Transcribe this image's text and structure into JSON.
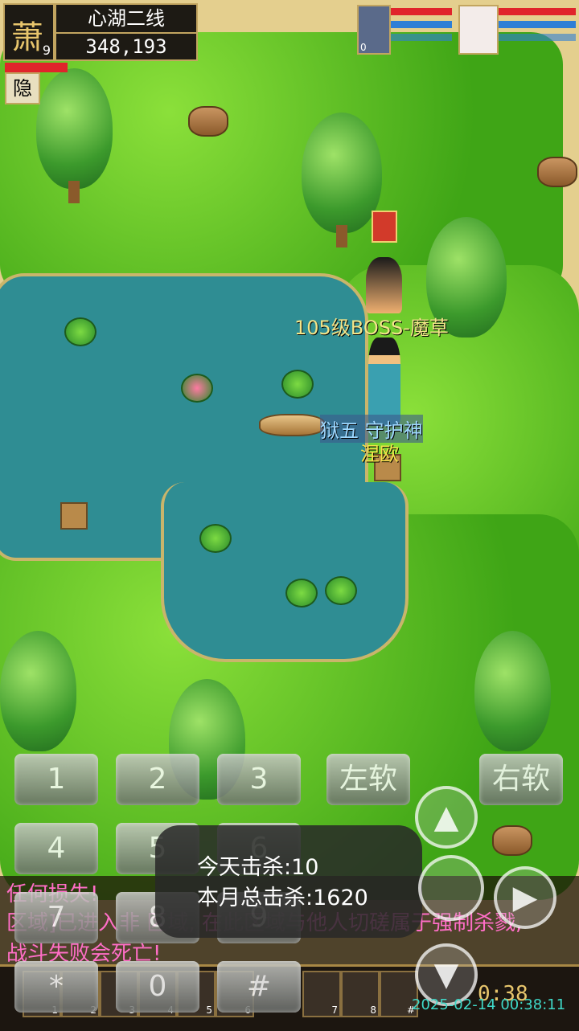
{
  "player": {
    "portrait_char": "萧",
    "level": "9",
    "map_name": "心湖二线",
    "gold": "348,193",
    "hide_button": "隐"
  },
  "party": [
    {
      "name": "pet-portrait",
      "badge": "0"
    },
    {
      "name": "companion-portrait"
    }
  ],
  "world_labels": {
    "boss_name": "105级BOSS-魔草",
    "guardian_name": "狱五  守护神",
    "player_name": "涅欧"
  },
  "keypad": {
    "keys": [
      "1",
      "2",
      "3",
      "4",
      "5",
      "6",
      "7",
      "8",
      "9",
      "*",
      "0",
      "#"
    ],
    "left_soft": "左软",
    "right_soft": "右软"
  },
  "chat": {
    "line1": "任何损失!",
    "line2": "区域]已进入非 区域, 在此区域与他人切磋属于强制杀戮,",
    "line3": "战斗失败会死亡!"
  },
  "kill_toast": {
    "today": "今天击杀:10",
    "month": "本月总击杀:1620"
  },
  "skill_slots": [
    "1",
    "2",
    "3",
    "4",
    "5",
    "6",
    "7",
    "8",
    "#"
  ],
  "clock": {
    "timer": "0:38",
    "datetime": "2025-02-14 00:38:11"
  },
  "colors": {
    "hp": "#e0242b",
    "mp": "#2f7fd6",
    "boss_label": "#f3e58a",
    "guardian_label": "#9fd8ff",
    "chat_text": "#ff6ec7"
  }
}
